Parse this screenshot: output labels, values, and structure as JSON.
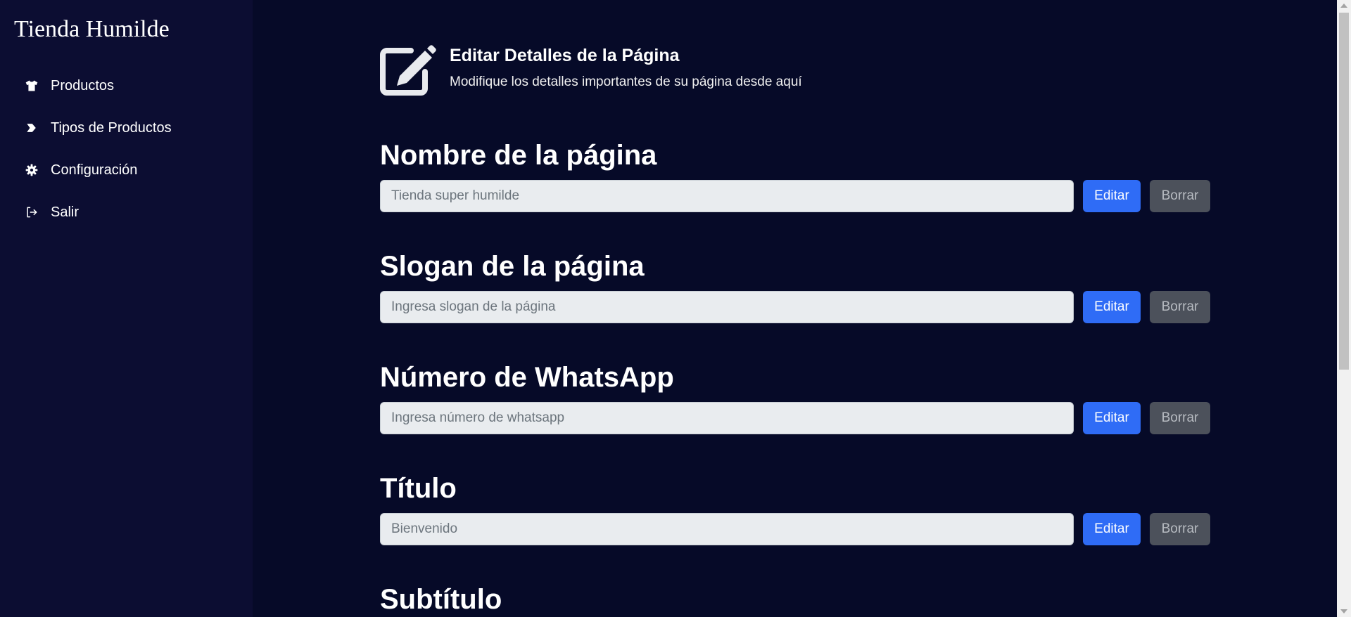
{
  "sidebar": {
    "brand": "Tienda Humilde",
    "items": [
      {
        "label": "Productos",
        "icon": "shirt-icon"
      },
      {
        "label": "Tipos de Productos",
        "icon": "chevron-tag-icon"
      },
      {
        "label": "Configuración",
        "icon": "gear-icon"
      },
      {
        "label": "Salir",
        "icon": "logout-icon"
      }
    ]
  },
  "header": {
    "icon": "edit-icon",
    "title": "Editar Detalles de la Página",
    "subtitle": "Modifique los detalles importantes de su página desde aquí"
  },
  "fields": [
    {
      "title": "Nombre de la página",
      "placeholder": "Tienda super humilde",
      "edit_label": "Editar",
      "delete_label": "Borrar"
    },
    {
      "title": "Slogan de la página",
      "placeholder": "Ingresa slogan de la página",
      "edit_label": "Editar",
      "delete_label": "Borrar"
    },
    {
      "title": "Número de WhatsApp",
      "placeholder": "Ingresa número de whatsapp",
      "edit_label": "Editar",
      "delete_label": "Borrar"
    },
    {
      "title": "Título",
      "placeholder": "Bienvenido",
      "edit_label": "Editar",
      "delete_label": "Borrar"
    },
    {
      "title": "Subtítulo"
    }
  ],
  "colors": {
    "sidebar_bg": "#0c0d32",
    "main_bg": "#060a28",
    "edit_button": "#2f6cf6",
    "delete_button": "#4c515b"
  }
}
